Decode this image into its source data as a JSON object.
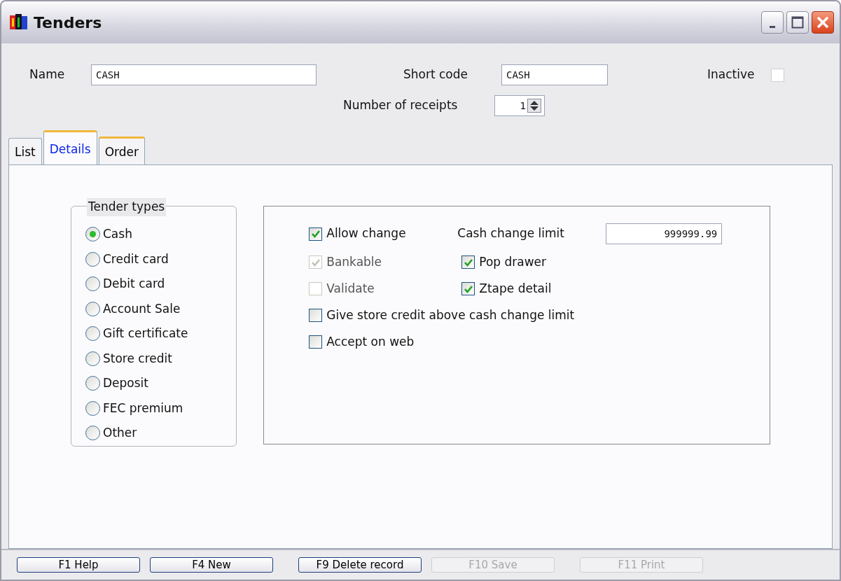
{
  "window": {
    "title": "Tenders"
  },
  "header": {
    "name": {
      "label": "Name",
      "value": "CASH"
    },
    "short_code": {
      "label": "Short code",
      "value": "CASH"
    },
    "inactive": {
      "label": "Inactive",
      "checked": false
    },
    "receipts": {
      "label": "Number of receipts",
      "value": "1"
    }
  },
  "tabs": [
    {
      "label": "List",
      "selected": false
    },
    {
      "label": "Details",
      "selected": true
    },
    {
      "label": "Order",
      "selected": false
    }
  ],
  "tender_types": {
    "title": "Tender types",
    "options": [
      {
        "label": "Cash",
        "selected": true
      },
      {
        "label": "Credit card",
        "selected": false
      },
      {
        "label": "Debit card",
        "selected": false
      },
      {
        "label": "Account Sale",
        "selected": false
      },
      {
        "label": "Gift certificate",
        "selected": false
      },
      {
        "label": "Store credit",
        "selected": false
      },
      {
        "label": "Deposit",
        "selected": false
      },
      {
        "label": "FEC premium",
        "selected": false
      },
      {
        "label": "Other",
        "selected": false
      }
    ]
  },
  "options_left": [
    {
      "label": "Allow change",
      "checked": true,
      "disabled": false
    },
    {
      "label": "Bankable",
      "checked": true,
      "disabled": true
    },
    {
      "label": "Validate",
      "checked": false,
      "disabled": true
    }
  ],
  "cash_change_limit": {
    "label": "Cash change limit",
    "value": "999999.99"
  },
  "options_right": [
    {
      "label": "Pop drawer",
      "checked": true,
      "disabled": false
    },
    {
      "label": "Ztape detail",
      "checked": true,
      "disabled": false
    }
  ],
  "options_wide": [
    {
      "label": "Give store credit above cash change limit",
      "checked": false,
      "disabled": false
    },
    {
      "label": "Accept on web",
      "checked": false,
      "disabled": false
    }
  ],
  "buttons": [
    {
      "label": "F1 Help",
      "disabled": false
    },
    {
      "label": "F4 New",
      "disabled": false
    },
    {
      "label": "F9 Delete record",
      "disabled": false
    },
    {
      "label": "F10 Save",
      "disabled": true
    },
    {
      "label": "F11 Print",
      "disabled": true
    }
  ]
}
